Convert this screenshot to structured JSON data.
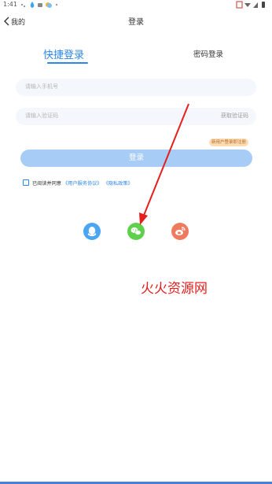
{
  "status_bar": {
    "time": "1:41"
  },
  "nav": {
    "back_label": "我的",
    "title": "登录"
  },
  "tabs": {
    "quick": "快捷登录",
    "password": "密码登录"
  },
  "form": {
    "phone_placeholder": "请输入手机号",
    "code_placeholder": "请输入验证码",
    "get_code_label": "获取验证码",
    "tooltip": "新用户登录即注册",
    "login_button": "登录"
  },
  "agreement": {
    "text": "已阅读并同意",
    "user_agreement": "《用户服务协议》",
    "privacy_policy": "《隐私政策》"
  },
  "social": [
    "qq-icon",
    "wechat-icon",
    "weibo-icon"
  ],
  "watermark": "火火资源网",
  "colors": {
    "accent": "#2e86e6",
    "button_bg": "#a7ccf5",
    "annotation": "#e61e1e"
  }
}
